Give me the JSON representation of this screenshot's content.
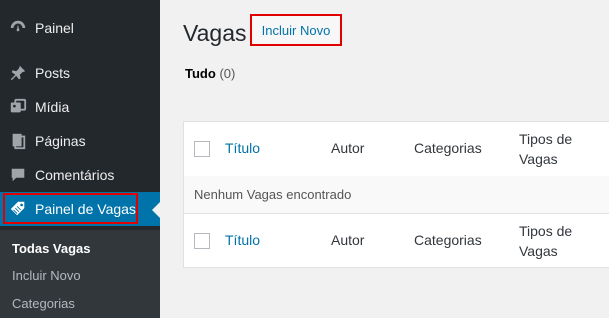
{
  "sidebar": {
    "items": [
      {
        "label": "Painel",
        "icon": "dashboard-icon"
      },
      {
        "label": "Posts",
        "icon": "pin-icon"
      },
      {
        "label": "Mídia",
        "icon": "media-icon"
      },
      {
        "label": "Páginas",
        "icon": "pages-icon"
      },
      {
        "label": "Comentários",
        "icon": "comments-icon"
      },
      {
        "label": "Painel de Vagas",
        "icon": "tag-icon",
        "active": true
      }
    ],
    "submenu": [
      {
        "label": "Todas Vagas",
        "current": true
      },
      {
        "label": "Incluir Novo"
      },
      {
        "label": "Categorias"
      }
    ]
  },
  "main": {
    "title": "Vagas",
    "add_new_label": "Incluir Novo",
    "filter": {
      "label": "Tudo",
      "count": "(0)"
    },
    "table": {
      "columns": [
        "Título",
        "Autor",
        "Categorias",
        "Tipos de Vagas"
      ],
      "empty_message": "Nenhum Vagas encontrado"
    }
  },
  "colors": {
    "sidebar_bg": "#23282d",
    "active_bg": "#0073aa",
    "link": "#0073aa",
    "highlight": "#e00000"
  }
}
